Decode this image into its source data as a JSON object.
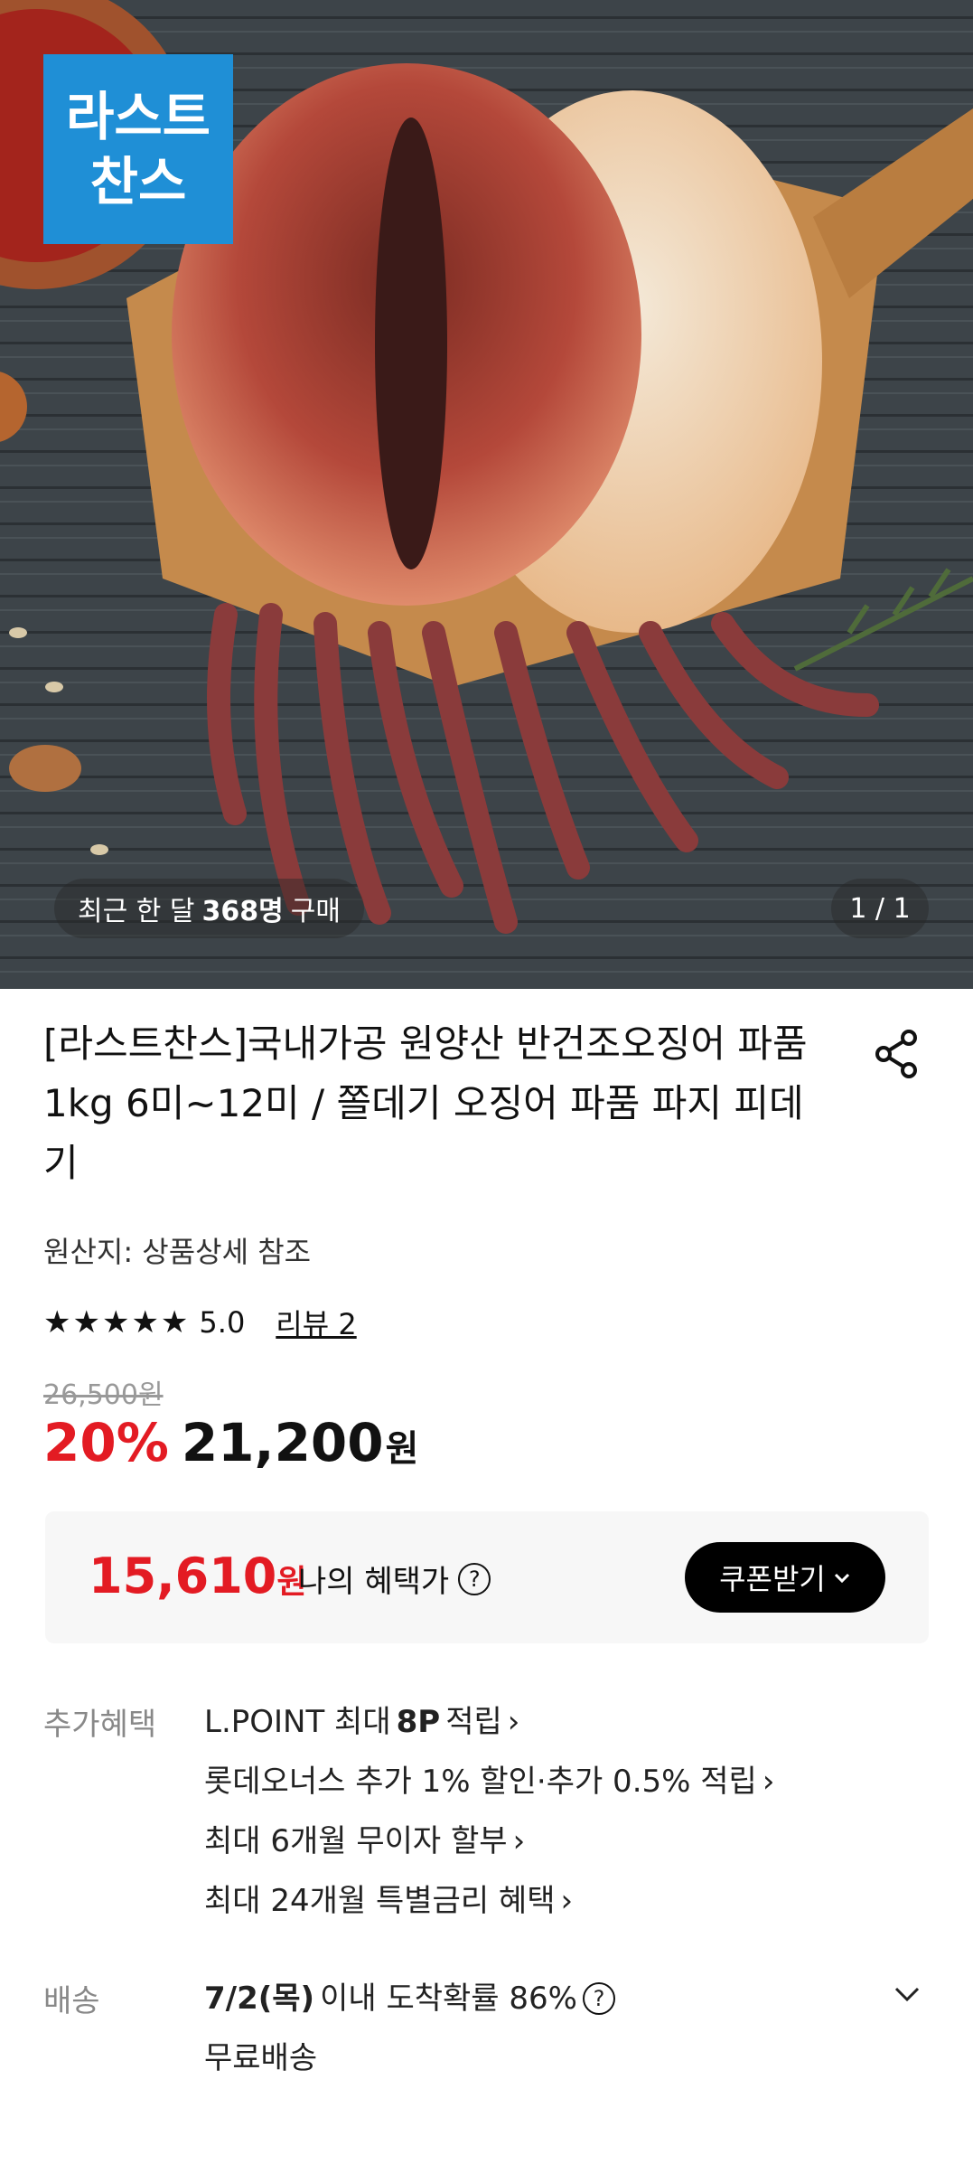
{
  "hero": {
    "badge_line1": "라스트",
    "badge_line2": "찬스",
    "recent_prefix": "최근 한 달",
    "recent_count": "368명",
    "recent_suffix": "구매",
    "pager": "1 / 1"
  },
  "product": {
    "title": "[라스트찬스]국내가공 원양산 반건조오징어 파품1kg 6미~12미 / 쫄데기 오징어 파품 파지 피데기",
    "origin": "원산지: 상품상세 참조",
    "stars": "★★★★★",
    "rating": "5.0",
    "review_link": "리뷰 2",
    "original_price": "26,500원",
    "discount": "20%",
    "sale_price": "21,200",
    "sale_unit": "원"
  },
  "benefit_box": {
    "price": "15,610",
    "unit": "원",
    "label": "나의 혜택가",
    "help": "?",
    "coupon_button": "쿠폰받기"
  },
  "extra_benefits": {
    "label": "추가혜택",
    "lpoint_prefix": "L.POINT 최대",
    "lpoint_bold": "8P",
    "lpoint_suffix": "적립",
    "lotte_onners": "롯데오너스 추가 1% 할인·추가 0.5% 적립",
    "installment": "최대 6개월 무이자 할부",
    "special_rate": "최대 24개월 특별금리 혜택"
  },
  "shipping": {
    "label": "배송",
    "date": "7/2(목)",
    "arrival": "이내 도착확률 86%",
    "help": "?",
    "free": "무료배송"
  },
  "icons": [
    "share-icon",
    "chevron-right-icon",
    "chevron-down-icon",
    "help-icon"
  ],
  "colors": {
    "accent_red": "#e31b23",
    "badge_blue": "#1f8fd6"
  }
}
